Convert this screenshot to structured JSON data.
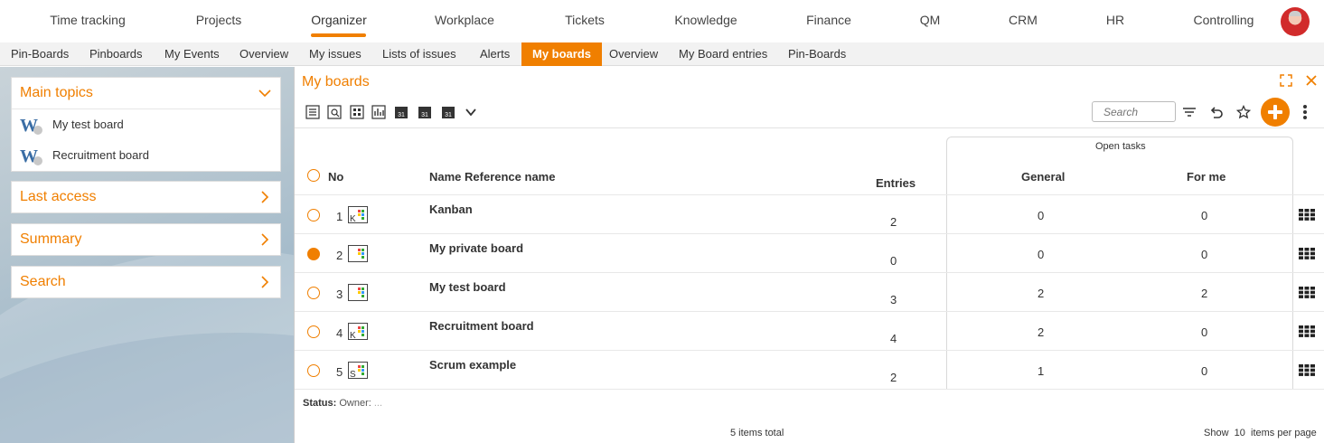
{
  "topnav": {
    "items": [
      "Time tracking",
      "Projects",
      "Organizer",
      "Workplace",
      "Tickets",
      "Knowledge",
      "Finance",
      "QM",
      "CRM",
      "HR",
      "Controlling"
    ],
    "active": "Organizer"
  },
  "subnav": {
    "items": [
      "Pin-Boards",
      "Pinboards",
      "My Events",
      "Overview",
      "My issues",
      "Lists of issues",
      "Alerts",
      "My boards",
      "Overview",
      "My Board entries",
      "Pin-Boards"
    ],
    "active_index": 7
  },
  "sidebar": {
    "main_topics": {
      "title": "Main topics",
      "items": [
        "My test board",
        "Recruitment board"
      ]
    },
    "last_access": "Last access",
    "summary": "Summary",
    "search": "Search"
  },
  "main": {
    "title": "My boards",
    "search_placeholder": "Search",
    "headers": {
      "no": "No",
      "name": "Name Reference name",
      "entries": "Entries",
      "open_tasks": "Open tasks",
      "general": "General",
      "for_me": "For me"
    },
    "rows": [
      {
        "no": "1",
        "icon_letter": "K",
        "name": "Kanban",
        "entries": "2",
        "general": "0",
        "for_me": "0",
        "selected": false
      },
      {
        "no": "2",
        "icon_letter": "",
        "name": "My private board",
        "entries": "0",
        "general": "0",
        "for_me": "0",
        "selected": true
      },
      {
        "no": "3",
        "icon_letter": "",
        "name": "My test board",
        "entries": "3",
        "general": "2",
        "for_me": "2",
        "selected": false
      },
      {
        "no": "4",
        "icon_letter": "K",
        "name": "Recruitment board",
        "entries": "4",
        "general": "2",
        "for_me": "0",
        "selected": false
      },
      {
        "no": "5",
        "icon_letter": "S",
        "name": "Scrum example",
        "entries": "2",
        "general": "1",
        "for_me": "0",
        "selected": false
      }
    ],
    "status": {
      "status_label": "Status:",
      "owner_label": "Owner:",
      "owner_value": "..."
    },
    "footer": {
      "total": "5 items total",
      "show": "Show",
      "per_page_value": "10",
      "per_page_label": "items per page"
    }
  },
  "colors": {
    "accent": "#f07f00"
  }
}
